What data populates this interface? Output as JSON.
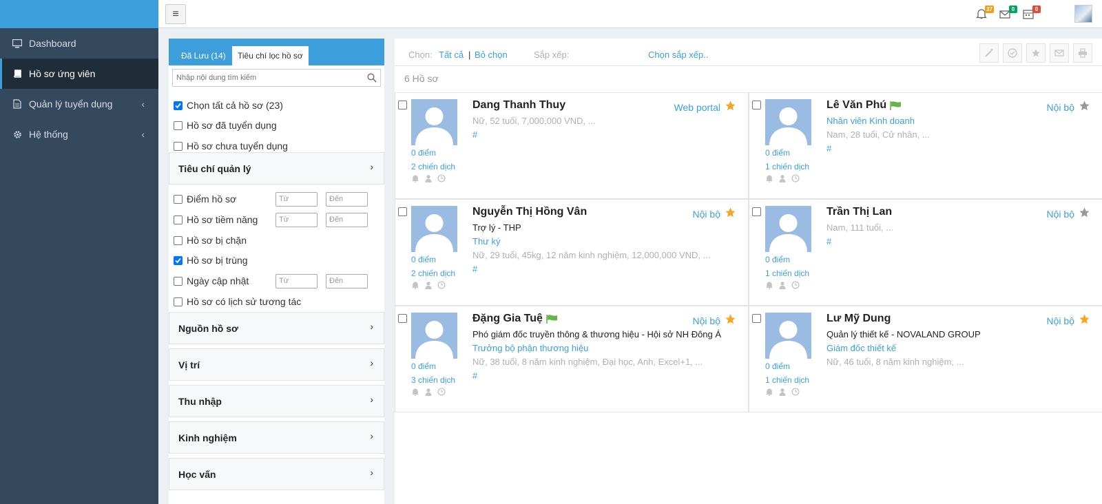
{
  "sidebar": {
    "items": [
      {
        "label": "Dashboard",
        "icon": "monitor-icon"
      },
      {
        "label": "Hồ sơ ứng viên",
        "icon": "book-icon"
      },
      {
        "label": "Quản lý tuyển dụng",
        "icon": "document-icon"
      },
      {
        "label": "Hệ thống",
        "icon": "gear-icon"
      }
    ]
  },
  "topbar": {
    "menu_icon": "≡",
    "notifications": {
      "count": "37",
      "color": "#f39c12"
    },
    "messages": {
      "count": "0",
      "color": "#00a65a"
    },
    "calendar": {
      "count": "0",
      "color": "#dd4b39"
    }
  },
  "filter": {
    "tabs": {
      "saved": "Đã Lưu (14)",
      "criteria": "Tiêu chí lọc hồ sơ"
    },
    "search_placeholder": "Nhập nội dung tìm kiếm",
    "select_all": "Chọn tất cả hồ sơ (23)",
    "recruited": "Hồ sơ đã tuyển dụng",
    "not_recruited": "Hồ sơ chưa tuyển dụng",
    "manage_section": "Tiêu chí quản lý",
    "score": "Điểm hồ sơ",
    "potential": "Hồ sơ tiềm năng",
    "blocked": "Hồ sơ bị chặn",
    "duplicate": "Hồ sơ bị trùng",
    "updated_date": "Ngày cập nhật",
    "history": "Hồ sơ có lịch sử tương tác",
    "from": "Từ",
    "to": "Đến",
    "sections": [
      "Nguồn hồ sơ",
      "Vị trí",
      "Thu nhập",
      "Kinh nghiệm",
      "Học vấn"
    ]
  },
  "toolbar": {
    "choose_label": "Chọn:",
    "all": "Tất cả",
    "separator": "|",
    "deselect": "Bỏ chọn",
    "sort_label": "Sắp xếp:",
    "sort_select": "Chọn sắp xếp.."
  },
  "count_label": "6 Hồ sơ",
  "candidates": [
    {
      "name": "Dang Thanh Thuy",
      "flag": false,
      "source": "Web portal",
      "star": "gold",
      "title": "",
      "position": "",
      "info": "Nữ, 52 tuổi, 7,000,000 VND, ...",
      "hash": "#",
      "score": "0 điểm",
      "campaigns": "2 chiến dịch"
    },
    {
      "name": "Lê Văn Phú",
      "flag": true,
      "source": "Nội bộ",
      "star": "gray",
      "title": "",
      "position": "Nhân viên Kinh doanh",
      "info": "Nam, 28 tuổi, Cử nhân, ...",
      "hash": "#",
      "score": "0 điểm",
      "campaigns": "1 chiến dịch"
    },
    {
      "name": "Nguyễn Thị Hồng Vân",
      "flag": false,
      "source": "Nội bộ",
      "star": "gold",
      "title": "Trợ lý - THP",
      "position": "Thư ký",
      "info": "Nữ, 29 tuổi, 45kg, 12 năm kinh nghiệm, 12,000,000 VND, ...",
      "hash": "#",
      "score": "0 điểm",
      "campaigns": "2 chiến dịch"
    },
    {
      "name": "Trần Thị Lan",
      "flag": false,
      "source": "Nội bộ",
      "star": "gray",
      "title": "",
      "position": "",
      "info": "Nam, 111 tuổi, ...",
      "hash": "#",
      "score": "0 điểm",
      "campaigns": "1 chiến dịch"
    },
    {
      "name": "Đặng Gia Tuệ",
      "flag": true,
      "source": "Nội bộ",
      "star": "gold",
      "title": "Phó giám đốc truyền thông & thương hiệu - Hội sở NH Đông Á",
      "position": "Trưởng bộ phận thương hiệu",
      "info": "Nữ, 38 tuổi, 8 năm kinh nghiệm, Đại học, Anh, Excel+1, ...",
      "hash": "#",
      "score": "0 điểm",
      "campaigns": "3 chiến dịch"
    },
    {
      "name": "Lư Mỹ Dung",
      "flag": false,
      "source": "Nội bộ",
      "star": "gold",
      "title": "Quản lý thiết kế - NOVALAND GROUP",
      "position": "Giám đốc thiết kế",
      "info": "Nữ, 46 tuổi, 8 năm kinh nghiệm, ...",
      "hash": "",
      "score": "0 điểm",
      "campaigns": "1 chiến dịch"
    }
  ],
  "colors": {
    "accent": "#3c9fdb",
    "sidebar": "#34495e",
    "star_gold": "#f5a623",
    "star_gray": "#999999",
    "flag_green": "#6ab04c"
  }
}
